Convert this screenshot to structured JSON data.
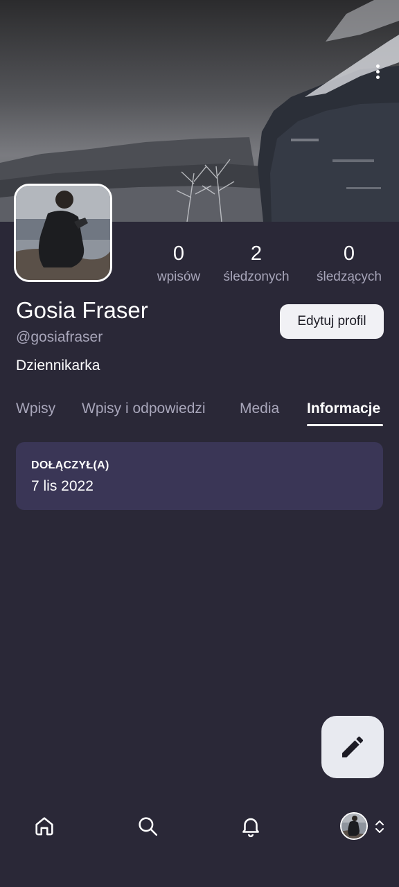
{
  "profile": {
    "name": "Gosia Fraser",
    "handle": "@gosiafraser",
    "bio": "Dziennikarka",
    "edit_label": "Edytuj profil"
  },
  "stats": {
    "posts": {
      "value": "0",
      "label": "wpisów"
    },
    "following": {
      "value": "2",
      "label": "śledzonych"
    },
    "followers": {
      "value": "0",
      "label": "śledzących"
    }
  },
  "tabs": [
    {
      "label": "Wpisy",
      "active": false
    },
    {
      "label": "Wpisy i odpowiedzi",
      "active": false
    },
    {
      "label": "Media",
      "active": false
    },
    {
      "label": "Informacje",
      "active": true
    }
  ],
  "info": {
    "joined_title": "DOŁĄCZYŁ(A)",
    "joined_date": "7 lis 2022"
  },
  "icons": {
    "menu": "more-vertical-icon",
    "compose": "pencil-icon",
    "nav": [
      "home-icon",
      "search-icon",
      "bell-icon",
      "avatar",
      "chevron-up-down-icon"
    ]
  },
  "colors": {
    "background": "#2a2837",
    "card": "#3a3656",
    "muted_text": "#a8a6ba",
    "button_bg": "#f1f1f5",
    "fab_bg": "#e8eaf0"
  }
}
